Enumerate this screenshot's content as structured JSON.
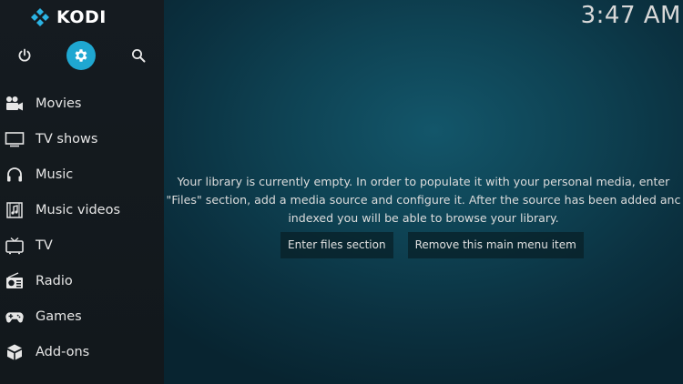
{
  "app": {
    "name": "KODI",
    "clock": "3:47 AM",
    "accent_color": "#1fa7d1"
  },
  "topbar": {
    "buttons": [
      {
        "icon": "power-icon",
        "label": "Power"
      },
      {
        "icon": "gear-icon",
        "label": "Settings",
        "active": true
      },
      {
        "icon": "search-icon",
        "label": "Search"
      }
    ]
  },
  "sidebar": {
    "items": [
      {
        "label": "Movies",
        "icon": "movie-camera-icon"
      },
      {
        "label": "TV shows",
        "icon": "monitor-icon"
      },
      {
        "label": "Music",
        "icon": "headphones-icon"
      },
      {
        "label": "Music videos",
        "icon": "music-video-icon"
      },
      {
        "label": "TV",
        "icon": "tv-icon"
      },
      {
        "label": "Radio",
        "icon": "radio-icon"
      },
      {
        "label": "Games",
        "icon": "gamepad-icon"
      },
      {
        "label": "Add-ons",
        "icon": "addons-box-icon"
      }
    ]
  },
  "main": {
    "empty_library": {
      "lines": [
        "Your library is currently empty. In order to populate it with your personal media, enter",
        "\"Files\" section, add a media source and configure it. After the source has been added anc",
        "indexed you will be able to browse your library."
      ]
    },
    "actions": {
      "enter_files": "Enter files section",
      "remove_item": "Remove this main menu item"
    }
  }
}
